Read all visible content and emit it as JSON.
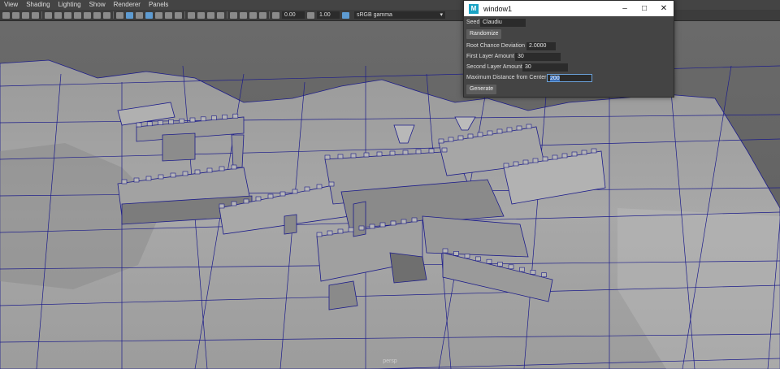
{
  "menubar": {
    "items": [
      "View",
      "Shading",
      "Lighting",
      "Show",
      "Renderer",
      "Panels"
    ]
  },
  "toolbar": {
    "exposure": "0.00",
    "gamma": "1.00",
    "color_space": "sRGB gamma"
  },
  "viewport": {
    "camera_label": "persp",
    "wire_color": "#1c1c8a"
  },
  "dialog": {
    "title": "window1",
    "seed_label": "Seed",
    "seed_value": "Claudiu",
    "randomize_label": "Randomize",
    "root_chance_label": "Root Chance Deviation",
    "root_chance_value": "2.0000",
    "first_layer_label": "First Layer Amount",
    "first_layer_value": "30",
    "second_layer_label": "Second Layer Amount",
    "second_layer_value": "30",
    "max_distance_label": "Maximum Distance from Center",
    "max_distance_value": "200",
    "generate_label": "Generate"
  }
}
